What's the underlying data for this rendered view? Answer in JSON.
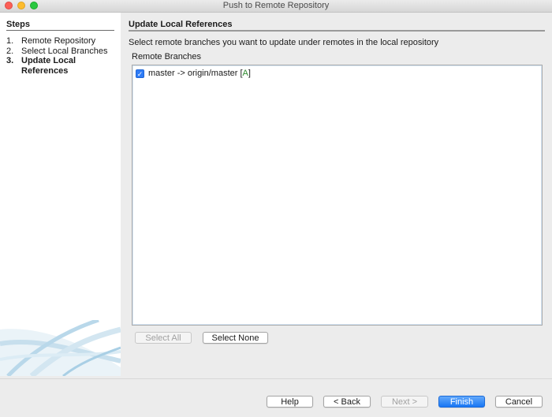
{
  "window": {
    "title": "Push to Remote Repository"
  },
  "sidebar": {
    "heading": "Steps",
    "steps": [
      {
        "number": "1.",
        "label": "Remote Repository",
        "current": false
      },
      {
        "number": "2.",
        "label": "Select Local Branches",
        "current": false
      },
      {
        "number": "3.",
        "label": "Update Local References",
        "current": true
      }
    ]
  },
  "main": {
    "heading": "Update Local References",
    "instruction": "Select remote branches you want to update under remotes in the local repository",
    "list_label": "Remote Branches",
    "branches": [
      {
        "local": "master",
        "arrow": "->",
        "remote": "origin/master",
        "tag": "A",
        "checked": true
      }
    ],
    "select_all_label": "Select All",
    "select_none_label": "Select None"
  },
  "footer": {
    "help_label": "Help",
    "back_label": "< Back",
    "next_label": "Next >",
    "finish_label": "Finish",
    "cancel_label": "Cancel"
  },
  "colors": {
    "accent": "#2f7cf6",
    "tag": "#2f8a2f"
  }
}
